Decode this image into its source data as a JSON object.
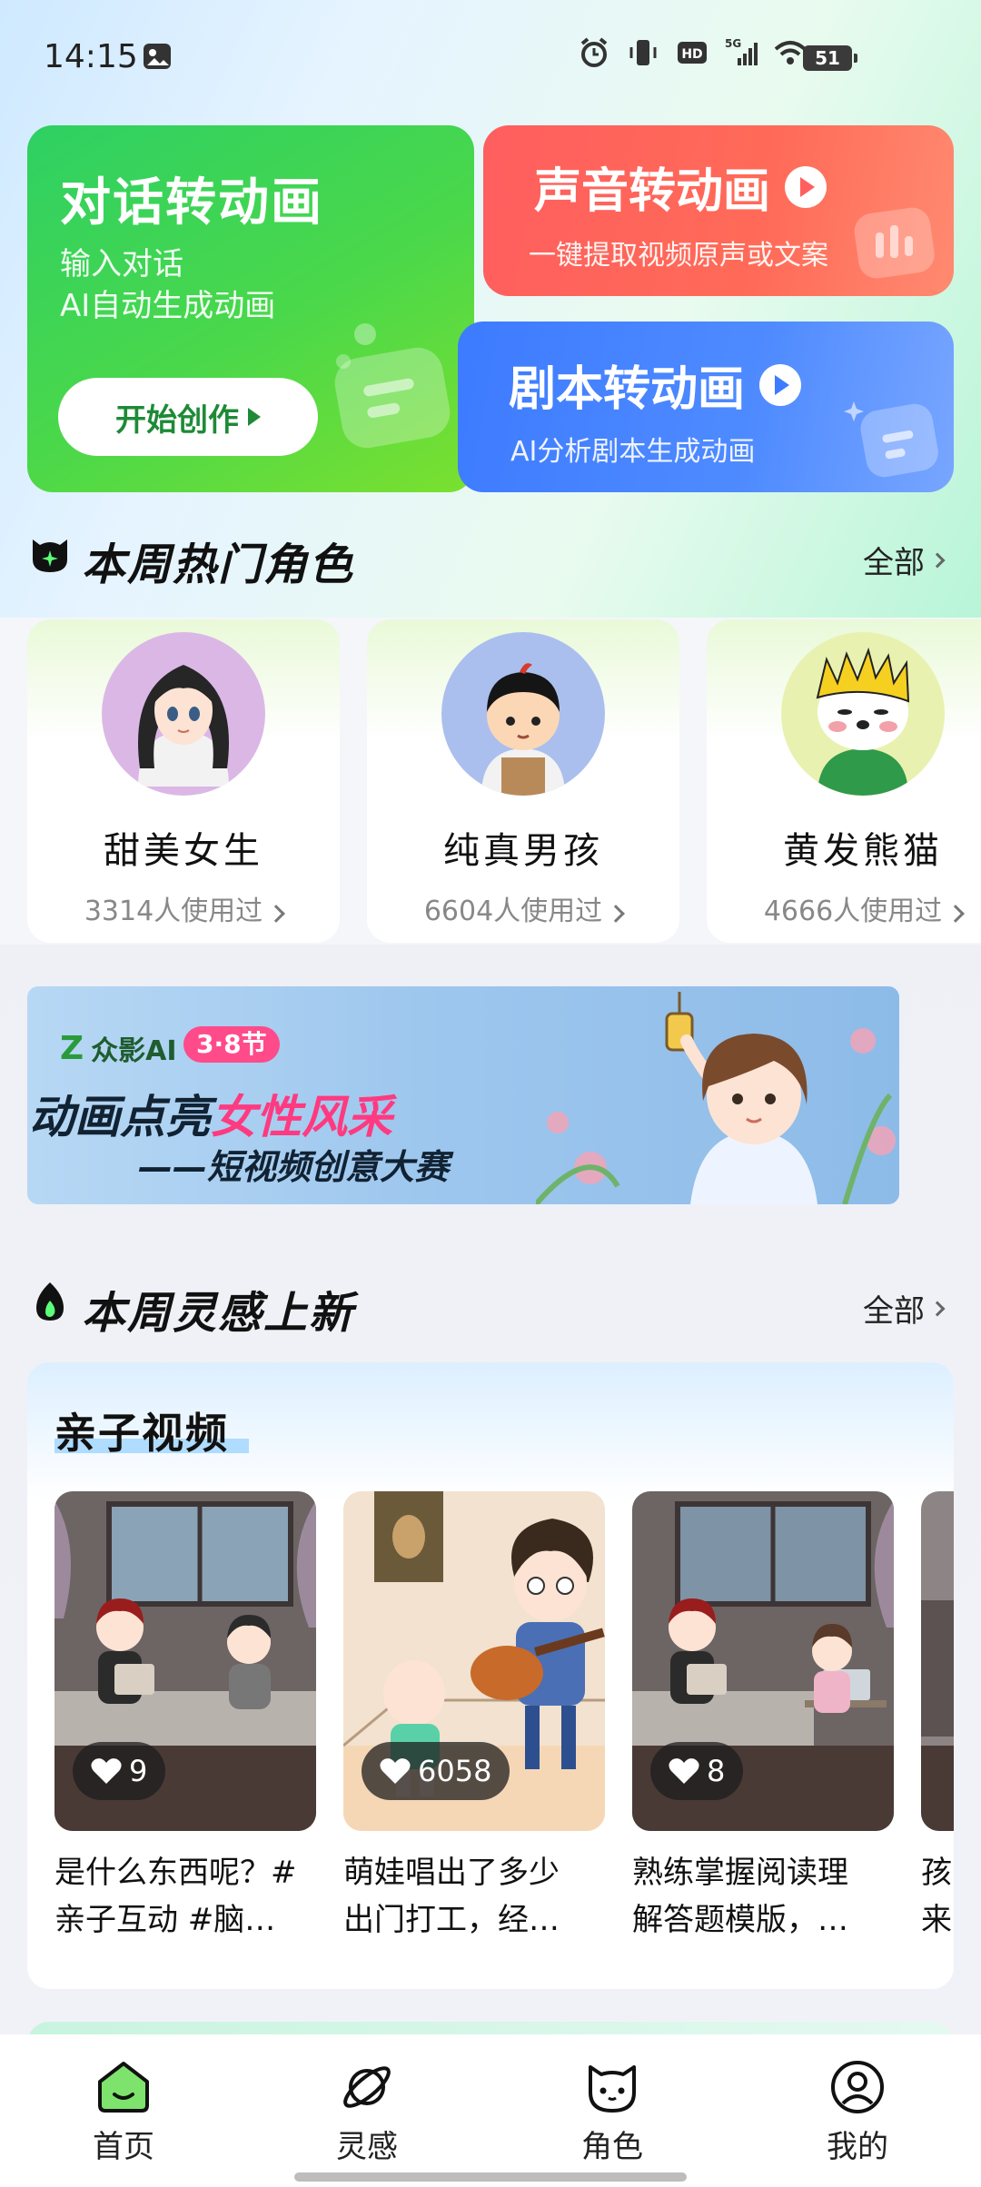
{
  "status_bar": {
    "time": "14:15",
    "battery": "51",
    "network": "5G"
  },
  "features": {
    "dialog": {
      "title": "对话转动画",
      "sub1": "输入对话",
      "sub2": "AI自动生成动画",
      "button": "开始创作"
    },
    "voice": {
      "title": "声音转动画",
      "sub": "一键提取视频原声或文案"
    },
    "script": {
      "title": "剧本转动画",
      "sub": "AI分析剧本生成动画"
    }
  },
  "hot_roles": {
    "title": "本周热门角色",
    "all": "全部",
    "items": [
      {
        "name": "甜美女生",
        "uses": "3314人使用过"
      },
      {
        "name": "纯真男孩",
        "uses": "6604人使用过"
      },
      {
        "name": "黄发熊猫",
        "uses": "4666人使用过"
      }
    ]
  },
  "banner": {
    "brand": "众影AI",
    "badge": "3·8节",
    "title_a": "动画点亮",
    "title_b": "女性风采",
    "subtitle": "——短视频创意大赛"
  },
  "inspiration": {
    "title": "本周灵感上新",
    "all": "全部",
    "category": "亲子视频",
    "videos": [
      {
        "likes": "9",
        "line1": "是什么东西呢？#",
        "line2": "亲子互动 #脑…"
      },
      {
        "likes": "6058",
        "line1": "萌娃唱出了多少",
        "line2": "出门打工，经…"
      },
      {
        "likes": "8",
        "line1": "熟练掌握阅读理",
        "line2": "解答题模版，…"
      },
      {
        "likes": "",
        "line1": "孩",
        "line2": "来"
      }
    ]
  },
  "nav": {
    "home": "首页",
    "inspire": "灵感",
    "role": "角色",
    "mine": "我的"
  },
  "colors": {
    "green": "#2ed063",
    "red": "#ff5e5e",
    "blue": "#3d7bff",
    "pink": "#ff3a80"
  }
}
